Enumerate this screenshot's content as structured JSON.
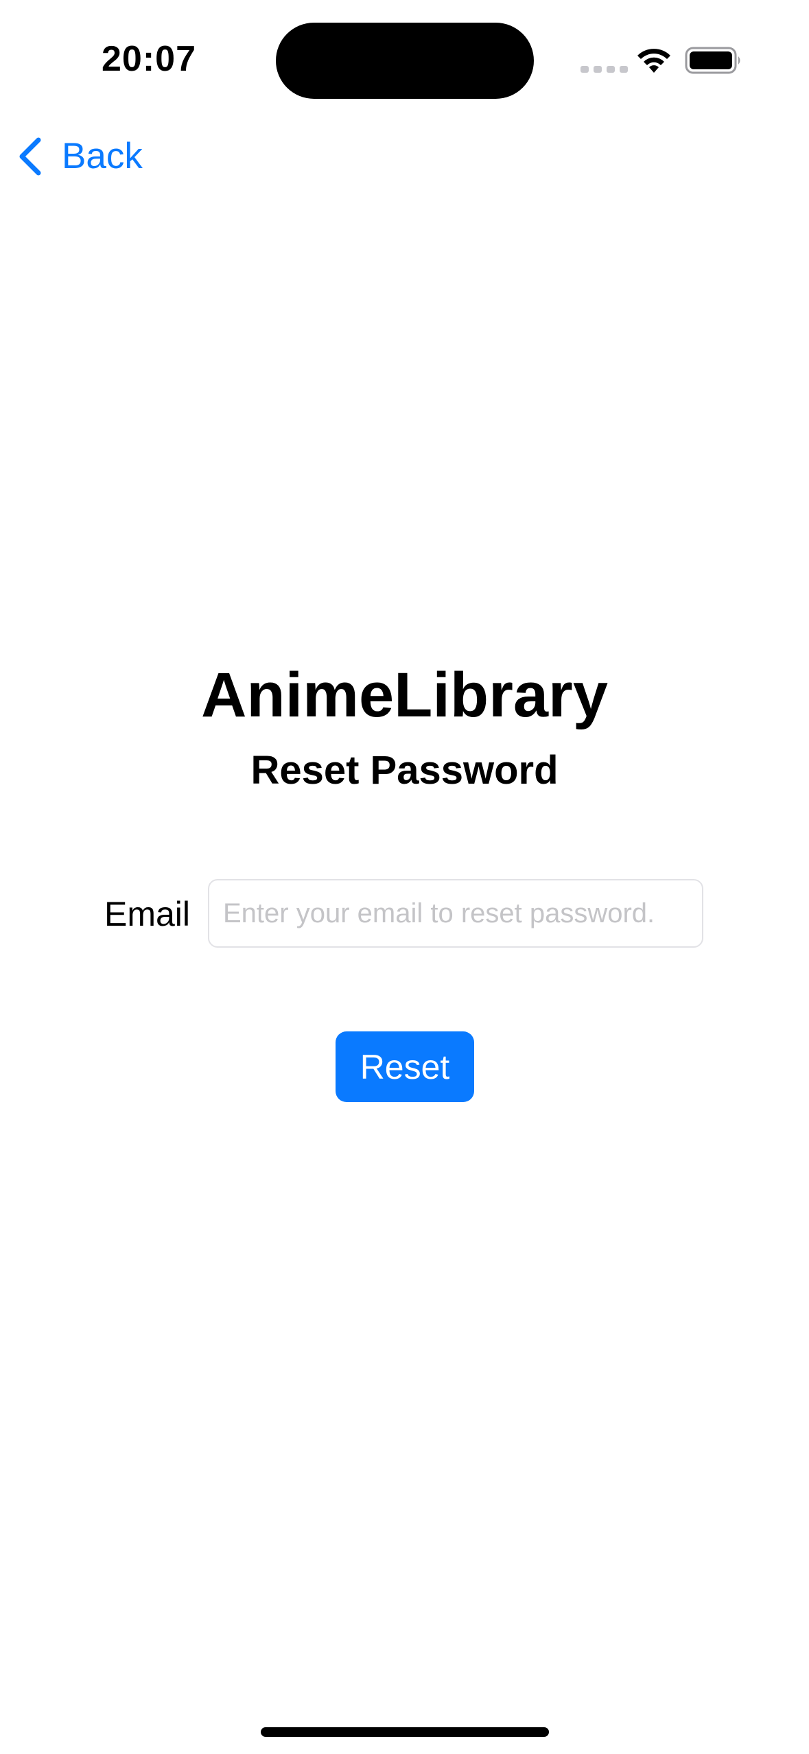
{
  "status_bar": {
    "time": "20:07"
  },
  "nav": {
    "back_label": "Back"
  },
  "header": {
    "app_title": "AnimeLibrary",
    "subtitle": "Reset Password"
  },
  "form": {
    "email_label": "Email",
    "email_value": "",
    "email_placeholder": "Enter your email to reset password.",
    "reset_label": "Reset"
  },
  "colors": {
    "accent": "#0a7aff",
    "background": "#ffffff",
    "text": "#000000",
    "placeholder": "#c4c4c7"
  },
  "icons": {
    "back": "chevron-left-icon",
    "wifi": "wifi-icon",
    "battery": "battery-icon",
    "signal": "cellular-signal-icon"
  }
}
